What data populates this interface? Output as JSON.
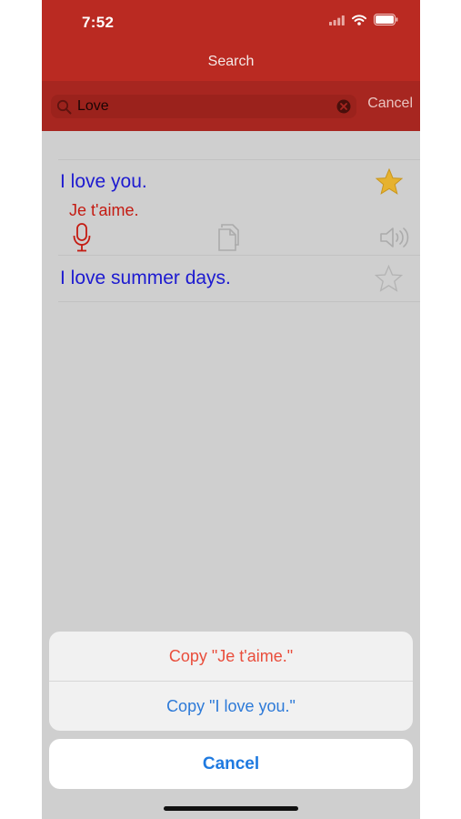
{
  "status": {
    "time": "7:52"
  },
  "nav": {
    "title": "Search"
  },
  "search": {
    "value": "Love",
    "cancel_label": "Cancel"
  },
  "results": [
    {
      "english": "I love you.",
      "french": "Je t'aime.",
      "favorite": true,
      "expanded": true
    },
    {
      "english": "I love summer days.",
      "favorite": false,
      "expanded": false
    }
  ],
  "action_sheet": {
    "copy_french": "Copy \"Je t'aime.\"",
    "copy_english": "Copy \"I love you.\"",
    "cancel": "Cancel"
  },
  "colors": {
    "header": "#ba2a22",
    "english_text": "#1d1ad0",
    "french_text": "#c41b12",
    "star": "#e6b22f",
    "sheet_french": "#e94d3b",
    "sheet_english": "#2d7ad8",
    "sheet_cancel": "#1f7ae0"
  },
  "icons": [
    "wifi-icon",
    "battery-icon",
    "search-icon",
    "clear-icon",
    "star-filled-icon",
    "microphone-icon",
    "copy-icon",
    "speaker-icon",
    "star-outline-icon"
  ]
}
